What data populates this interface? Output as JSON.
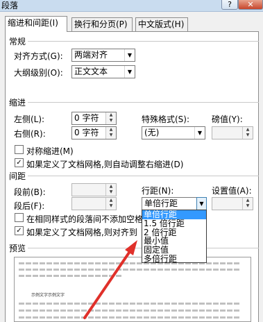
{
  "window": {
    "title": "段落",
    "help_label": "?",
    "close_label": "✕"
  },
  "tabs": [
    {
      "label": "缩进和间距(I)"
    },
    {
      "label": "换行和分页(P)"
    },
    {
      "label": "中文版式(H)"
    }
  ],
  "general": {
    "heading": "常规",
    "alignment_label": "对齐方式(G):",
    "alignment_value": "两端对齐",
    "outline_label": "大纲级别(O):",
    "outline_value": "正文文本"
  },
  "indent": {
    "heading": "缩进",
    "left_label": "左侧(L):",
    "left_value": "0 字符",
    "right_label": "右侧(R):",
    "right_value": "0 字符",
    "special_label": "特殊格式(S):",
    "special_value": "(无)",
    "by_label": "磅值(Y):",
    "mirror_label": "对称缩进(M)",
    "auto_adjust_label": "如果定义了文档网格,则自动调整右缩进(D)"
  },
  "spacing": {
    "heading": "间距",
    "before_label": "段前(B):",
    "after_label": "段后(F):",
    "line_label": "行距(N):",
    "line_value": "单倍行距",
    "at_label": "设置值(A):",
    "no_space_label": "在相同样式的段落间不添加空格",
    "snap_grid_label": "如果定义了文档网格,则对齐到"
  },
  "line_spacing_options": [
    "单倍行距",
    "1.5 倍行距",
    "2 倍行距",
    "最小值",
    "固定值",
    "多倍行距"
  ],
  "preview": {
    "heading": "预览",
    "sample_text": "示例文字示例文字"
  },
  "icons": {
    "dropdown_arrow": "▼",
    "spin_up": "▲",
    "spin_down": "▼",
    "check": "✓"
  },
  "colors": {
    "selection": "#3399ff",
    "annotation_arrow": "#e0302a",
    "title_bar": "#c9dcef"
  }
}
